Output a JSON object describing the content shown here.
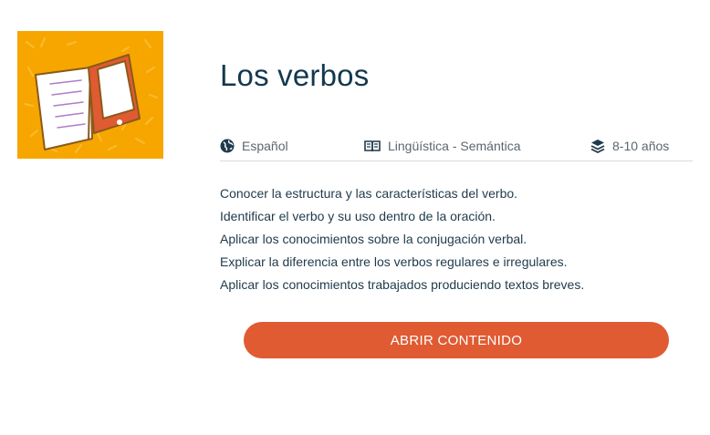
{
  "title": "Los verbos",
  "meta": {
    "language": "Español",
    "language_icon": "globe-icon",
    "area": "Lingüística - Semántica",
    "area_icon": "book-icon",
    "age": "8-10 años",
    "age_icon": "layers-icon"
  },
  "objectives": [
    "Conocer la estructura y las características del verbo.",
    "Identificar el verbo y su uso dentro de la oración.",
    "Aplicar los conocimientos sobre la conjugación verbal.",
    "Explicar la diferencia entre los verbos regulares e irregulares.",
    "Aplicar los conocimientos trabajados produciendo textos breves."
  ],
  "button": {
    "label": "ABRIR CONTENIDO"
  },
  "colors": {
    "accent": "#e05a32",
    "thumbnail_bg": "#f7a600",
    "title": "#13384f"
  },
  "thumbnail_icon": "book-and-tablet-illustration"
}
